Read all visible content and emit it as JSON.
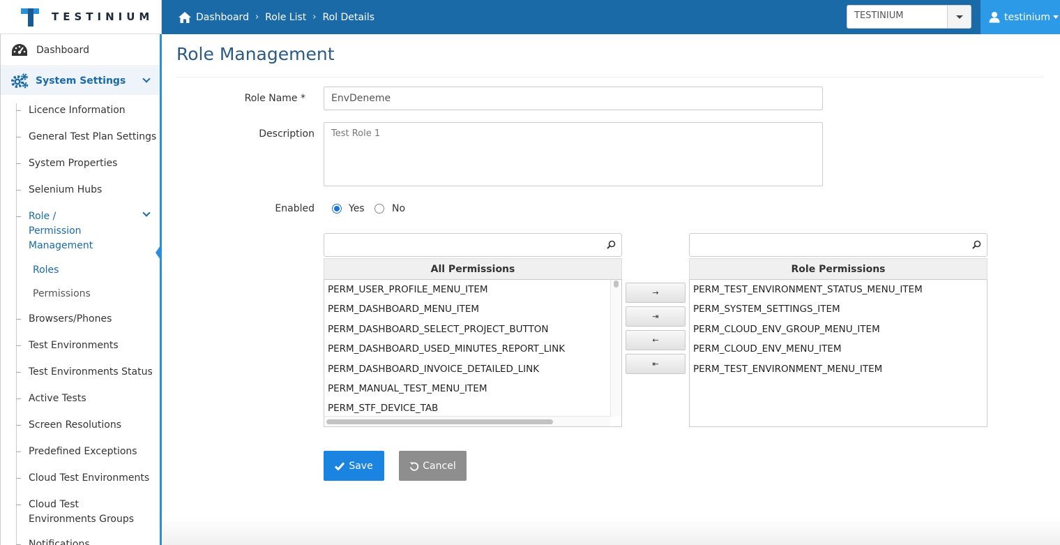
{
  "brand": {
    "logo_text": "TESTINIUM"
  },
  "breadcrumb": {
    "items": [
      "Dashboard",
      "Role List",
      "Rol Details"
    ],
    "separator": "›"
  },
  "project_select": {
    "value": "TESTINIUM"
  },
  "user_menu": {
    "username": "testinium"
  },
  "sidebar": {
    "dashboard": "Dashboard",
    "system_settings": "System Settings",
    "items": [
      "Licence Information",
      "General Test Plan Settings",
      "System Properties",
      "Selenium Hubs",
      "Role / Permission Management",
      "Browsers/Phones",
      "Test Environments",
      "Test Environments Status",
      "Active Tests",
      "Screen Resolutions",
      "Predefined Exceptions",
      "Cloud Test Environments",
      "Cloud Test Environments Groups",
      "Notifications"
    ],
    "role_submenu": [
      "Roles",
      "Permissions"
    ]
  },
  "page": {
    "title": "Role Management"
  },
  "form": {
    "role_name_label": "Role Name *",
    "role_name_value": "EnvDeneme",
    "description_label": "Description",
    "description_value": "Test Role 1",
    "enabled_label": "Enabled",
    "enabled_yes": "Yes",
    "enabled_no": "No",
    "enabled_selected": "Yes"
  },
  "picklist": {
    "source_header": "All Permissions",
    "target_header": "Role Permissions",
    "source_items": [
      "PERM_USER_PROFILE_MENU_ITEM",
      "PERM_DASHBOARD_MENU_ITEM",
      "PERM_DASHBOARD_SELECT_PROJECT_BUTTON",
      "PERM_DASHBOARD_USED_MINUTES_REPORT_LINK",
      "PERM_DASHBOARD_INVOICE_DETAILED_LINK",
      "PERM_MANUAL_TEST_MENU_ITEM",
      "PERM_STF_DEVICE_TAB"
    ],
    "target_items": [
      "PERM_TEST_ENVIRONMENT_STATUS_MENU_ITEM",
      "PERM_SYSTEM_SETTINGS_ITEM",
      "PERM_CLOUD_ENV_GROUP_MENU_ITEM",
      "PERM_CLOUD_ENV_MENU_ITEM",
      "PERM_TEST_ENVIRONMENT_MENU_ITEM"
    ],
    "controls": [
      "→",
      "⇥",
      "←",
      "⇤"
    ]
  },
  "buttons": {
    "save": "Save",
    "cancel": "Cancel"
  },
  "colors": {
    "topbar": "#1a6aa8",
    "accent": "#2b8fd8",
    "save": "#1a84e0",
    "cancel": "#8e8e8e"
  }
}
